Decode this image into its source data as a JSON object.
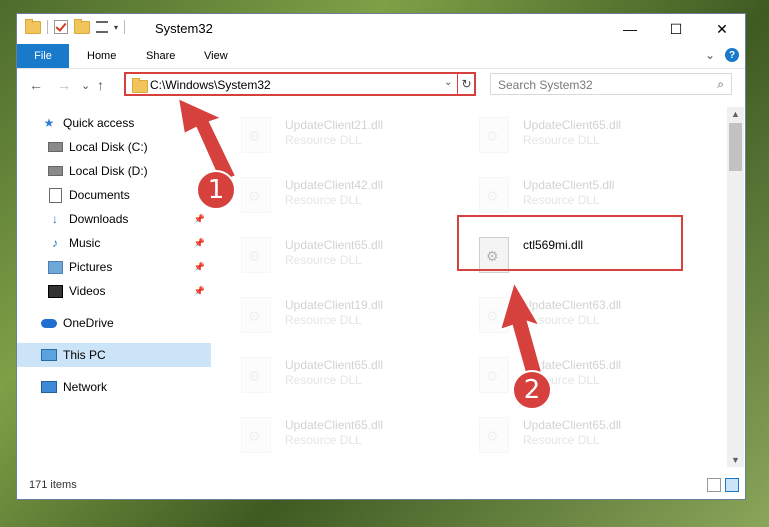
{
  "window": {
    "title": "System32",
    "minimize_icon": "minimize-icon",
    "maximize_icon": "maximize-icon",
    "close_icon": "close-icon",
    "minimize_glyph": "—",
    "maximize_glyph": "☐",
    "close_glyph": "✕"
  },
  "quick_access_toolbar": {
    "dropdown_glyph": "▾"
  },
  "ribbon": {
    "tabs": [
      {
        "label": "File"
      },
      {
        "label": "Home"
      },
      {
        "label": "Share"
      },
      {
        "label": "View"
      }
    ],
    "expand_glyph": "⌄",
    "help_glyph": "?"
  },
  "navigation": {
    "back_glyph": "←",
    "forward_glyph": "→",
    "recent_glyph": "⌄",
    "up_glyph": "↑"
  },
  "address_bar": {
    "path": "C:\\Windows\\System32",
    "dropdown_glyph": "⌄",
    "refresh_glyph": "↻"
  },
  "search": {
    "placeholder": "Search System32",
    "icon_glyph": "⌕"
  },
  "nav_pane": {
    "items": [
      {
        "label": "Quick access",
        "icon": "star-icon",
        "pinned": false,
        "selected": false
      },
      {
        "label": "Local Disk (C:)",
        "icon": "drive-icon",
        "pinned": false,
        "selected": false
      },
      {
        "label": "Local Disk (D:)",
        "icon": "drive-icon",
        "pinned": false,
        "selected": false
      },
      {
        "label": "Documents",
        "icon": "documents-icon",
        "pinned": false,
        "selected": false
      },
      {
        "label": "Downloads",
        "icon": "downloads-icon",
        "pinned": true,
        "selected": false
      },
      {
        "label": "Music",
        "icon": "music-icon",
        "pinned": true,
        "selected": false
      },
      {
        "label": "Pictures",
        "icon": "pictures-icon",
        "pinned": true,
        "selected": false
      },
      {
        "label": "Videos",
        "icon": "videos-icon",
        "pinned": true,
        "selected": false
      },
      {
        "label": "OneDrive",
        "icon": "onedrive-icon",
        "pinned": false,
        "selected": false
      },
      {
        "label": "This PC",
        "icon": "this-pc-icon",
        "pinned": false,
        "selected": true
      },
      {
        "label": "Network",
        "icon": "network-icon",
        "pinned": false,
        "selected": false
      }
    ],
    "star_glyph": "★",
    "downloads_glyph": "↓",
    "music_glyph": "♪",
    "pin_glyph": "📌"
  },
  "files": {
    "left_column": [
      {
        "name": "UpdateClient21.dll",
        "type": "Resource DLL"
      },
      {
        "name": "UpdateClient42.dll",
        "type": "Resource DLL"
      },
      {
        "name": "UpdateClient65.dll",
        "type": "Resource DLL"
      },
      {
        "name": "UpdateClient19.dll",
        "type": "Resource DLL"
      },
      {
        "name": "UpdateClient65.dll",
        "type": "Resource DLL"
      },
      {
        "name": "UpdateClient65.dll",
        "type": "Resource DLL"
      }
    ],
    "right_column": [
      {
        "name": "UpdateClient65.dll",
        "type": "Resource DLL"
      },
      {
        "name": "UpdateClient5.dll",
        "type": "Resource DLL"
      },
      {
        "name": "ctl569mi.dll",
        "type": ""
      },
      {
        "name": "UpdateClient63.dll",
        "type": "Resource DLL"
      },
      {
        "name": "UpdateClient65.dll",
        "type": "Resource DLL"
      },
      {
        "name": "UpdateClient65.dll",
        "type": "Resource DLL"
      }
    ],
    "highlighted_file": "ctl569mi.dll"
  },
  "scrollbar": {
    "up_glyph": "▲",
    "down_glyph": "▼"
  },
  "status_bar": {
    "item_count": "171 items"
  },
  "annotations": {
    "badge1": "1",
    "badge2": "2",
    "color": "#d6403d"
  },
  "colors": {
    "accent": "#1979ca",
    "selection": "#cce4f7",
    "annotation_red": "#d6403d"
  }
}
